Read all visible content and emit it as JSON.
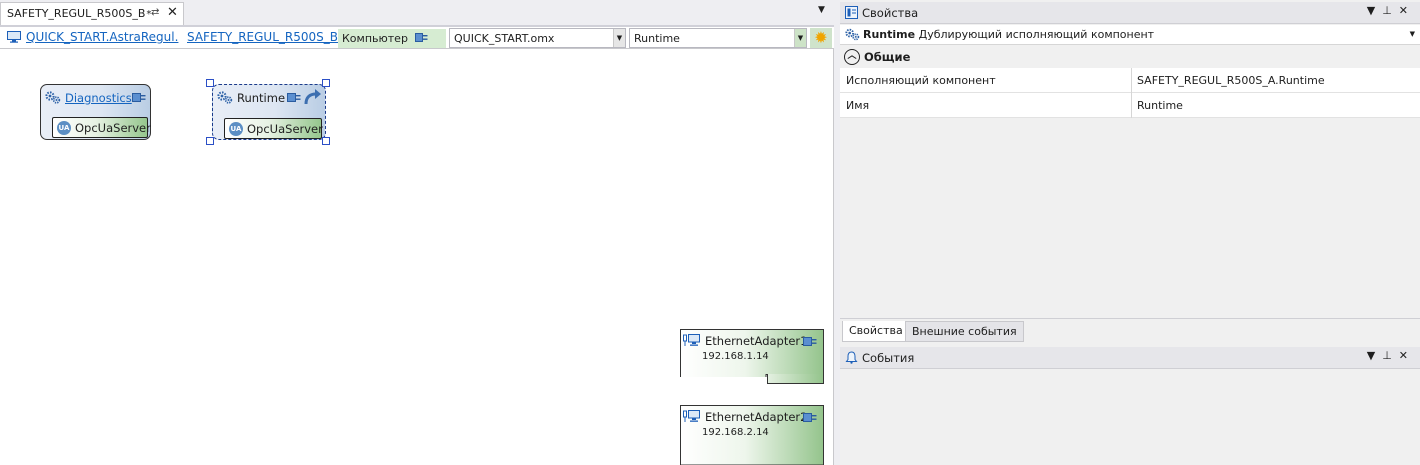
{
  "editor": {
    "tab": {
      "title": "SAFETY_REGUL_R500S_B",
      "modified_mark": "*",
      "pin_glyph": "⇄",
      "close_glyph": "✕"
    },
    "tab_menu_glyph": "▼",
    "toolbar": {
      "crumb1": "QUICK_START.AstraRegul.",
      "crumb2": "SAFETY_REGUL_R500S_B",
      "computer_label": "Компьютер",
      "file_combo": "QUICK_START.omx",
      "runtime_combo": "Runtime"
    },
    "canvas": {
      "nodes": [
        {
          "title": "Diagnostics",
          "service": "OpcUaServer"
        },
        {
          "title": "Runtime",
          "service": "OpcUaServer"
        }
      ],
      "adapters": [
        {
          "name": "EthernetAdapter1",
          "ip": "192.168.1.14"
        },
        {
          "name": "EthernetAdapter2",
          "ip": "192.168.2.14"
        }
      ]
    }
  },
  "properties_panel": {
    "title": "Свойства",
    "selected_object": {
      "name": "Runtime",
      "type": "Дублирующий исполняющий компонент"
    },
    "category": "Общие",
    "rows": [
      {
        "name": "Исполняющий компонент",
        "value": "SAFETY_REGUL_R500S_A.Runtime"
      },
      {
        "name": "Имя",
        "value": "Runtime"
      }
    ],
    "tabs": [
      "Свойства",
      "Внешние события"
    ]
  },
  "events_panel": {
    "title": "События"
  },
  "panel_buttons": {
    "dropdown": "▼",
    "pin": "⊥",
    "close": "✕"
  },
  "colors": {
    "accent_link": "#1565c0",
    "selection": "#2b4fc6",
    "service_green": "#95c68d",
    "node_blue": "#b9cde4",
    "computer_green": "#d6ecd2"
  }
}
